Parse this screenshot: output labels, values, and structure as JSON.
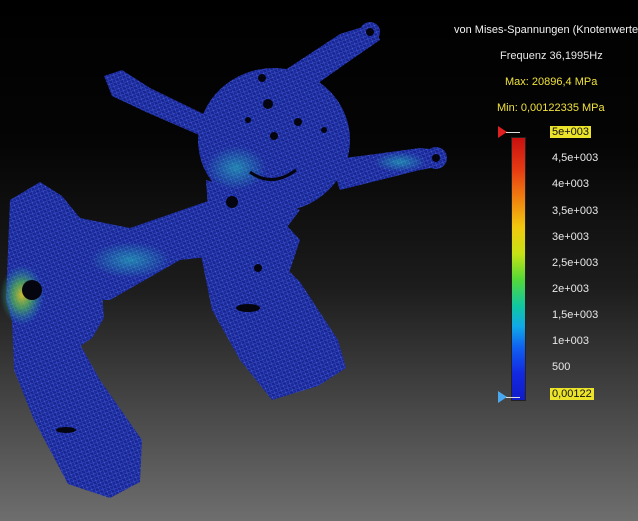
{
  "legend": {
    "title": "von Mises-Spannungen (Knotenwerte)",
    "frequency": "Frequenz 36,1995Hz",
    "max": "Max: 20896,4 MPa",
    "min": "Min: 0,00122335 MPa",
    "ticks": [
      "5e+003",
      "4,5e+003",
      "4e+003",
      "3,5e+003",
      "3e+003",
      "2,5e+003",
      "2e+003",
      "1,5e+003",
      "1e+003",
      "500",
      "0,00122"
    ],
    "colormap": [
      "#c81010",
      "#f07a10",
      "#f2c80e",
      "#54d838",
      "#10c8a0",
      "#10a8e8",
      "#101cc8"
    ],
    "highlight_color": "#ece42a"
  },
  "model": {
    "mesh_base_color": "#1a2a9a",
    "hotspot_colors": [
      "#2ec8c8",
      "#7ad23a",
      "#e0d020",
      "#e04020"
    ]
  }
}
